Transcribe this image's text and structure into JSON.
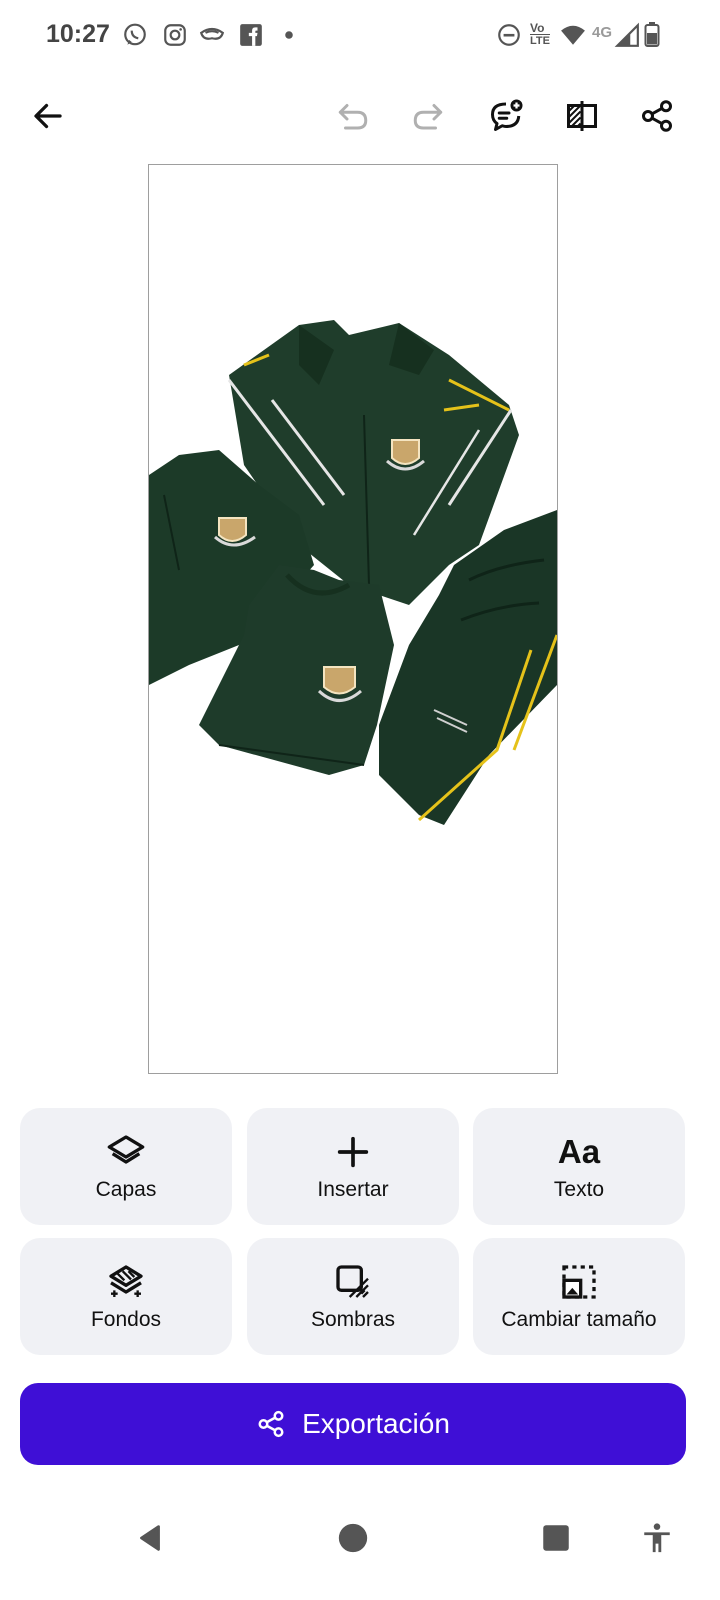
{
  "status_bar": {
    "time": "10:27",
    "notification_icons": [
      "whatsapp-icon",
      "instagram-icon",
      "mask-icon",
      "facebook-icon",
      "dot-icon"
    ],
    "right_icons": [
      "do-not-disturb-icon",
      "volte-icon",
      "wifi-icon",
      "cell-signal-icon",
      "battery-icon"
    ],
    "volte_top": "Vo",
    "volte_bottom": "LTE",
    "network": "4G"
  },
  "toolbar": {
    "back_icon": "arrow-left-icon",
    "undo_icon": "undo-icon",
    "redo_icon": "redo-icon",
    "comment_icon": "comment-add-icon",
    "compare_icon": "compare-icon",
    "share_icon": "share-icon"
  },
  "canvas": {
    "image": "school-uniform-set-photo"
  },
  "tools": [
    {
      "label": "Capas",
      "icon": "layers-icon"
    },
    {
      "label": "Insertar",
      "icon": "plus-icon"
    },
    {
      "label": "Texto",
      "icon": "text-icon",
      "glyph": "Aa"
    },
    {
      "label": "Fondos",
      "icon": "backgrounds-icon"
    },
    {
      "label": "Sombras",
      "icon": "shadows-icon"
    },
    {
      "label": "Cambiar tamaño",
      "icon": "resize-icon"
    }
  ],
  "export": {
    "label": "Exportación",
    "icon": "share-icon"
  },
  "nav_bar": {
    "items": [
      "back-triangle-icon",
      "home-circle-icon",
      "recents-square-icon",
      "accessibility-icon"
    ]
  },
  "colors": {
    "accent": "#3f0fd6",
    "tile_bg": "#f0f1f5",
    "uniform_green": "#1f3d2b",
    "stripe_yellow": "#e5c21a"
  }
}
